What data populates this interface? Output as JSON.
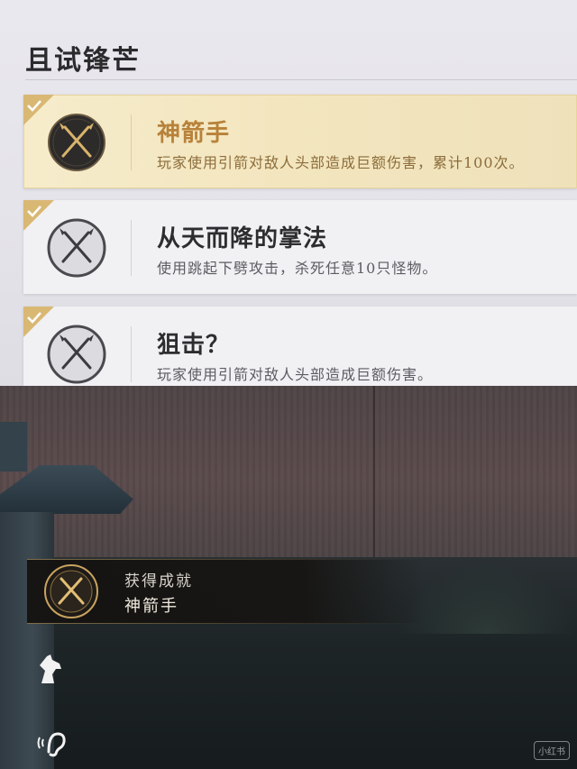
{
  "panel": {
    "title": "且试锋芒"
  },
  "achievements": [
    {
      "name": "神箭手",
      "desc": "玩家使用引箭对敌人头部造成巨额伤害，累计100次。",
      "state": "unlocked",
      "icon": "crossed-arrows-icon"
    },
    {
      "name": "从天而降的掌法",
      "desc": "使用跳起下劈攻击，杀死任意10只怪物。",
      "state": "completed",
      "icon": "crossed-swords-icon"
    },
    {
      "name": "狙击？",
      "desc": "玩家使用引箭对敌人头部造成巨额伤害。",
      "state": "completed",
      "icon": "crossed-swords-icon"
    }
  ],
  "toast": {
    "label": "获得成就",
    "name": "神箭手"
  },
  "hud": {
    "horse_icon": "horse-head-icon",
    "sound_icon": "ear-icon"
  },
  "watermark": "小红书",
  "colors": {
    "gold": "#b8823a",
    "gold_bg": "#f6eccb",
    "card_bg": "#f1f0f3",
    "panel_bg": "#e6e5eb"
  }
}
